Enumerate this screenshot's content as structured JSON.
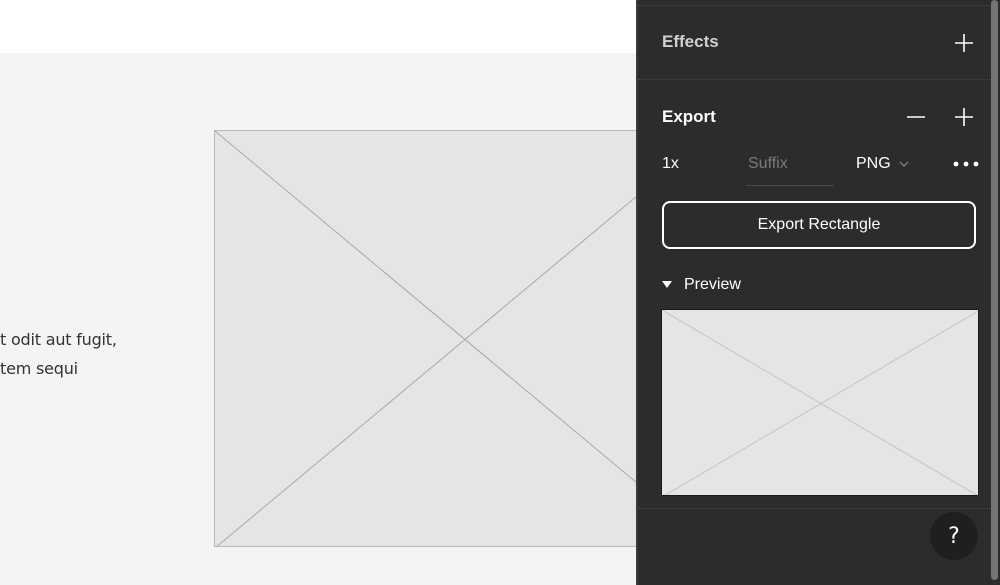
{
  "canvas": {
    "body_text_lines": [
      "t odit aut fugit,",
      "tem sequi"
    ]
  },
  "panel": {
    "effects": {
      "title": "Effects",
      "add_icon": "plus-icon"
    },
    "export": {
      "title": "Export",
      "remove_icon": "minus-icon",
      "add_icon": "plus-icon",
      "scale": "1x",
      "suffix_placeholder": "Suffix",
      "suffix_value": "",
      "format": "PNG",
      "format_icon": "chevron-down-icon",
      "more_icon": "more-horizontal-icon",
      "export_button_label": "Export Rectangle",
      "preview_label": "Preview",
      "preview_toggle_icon": "triangle-down-icon"
    },
    "help_label": "?"
  }
}
